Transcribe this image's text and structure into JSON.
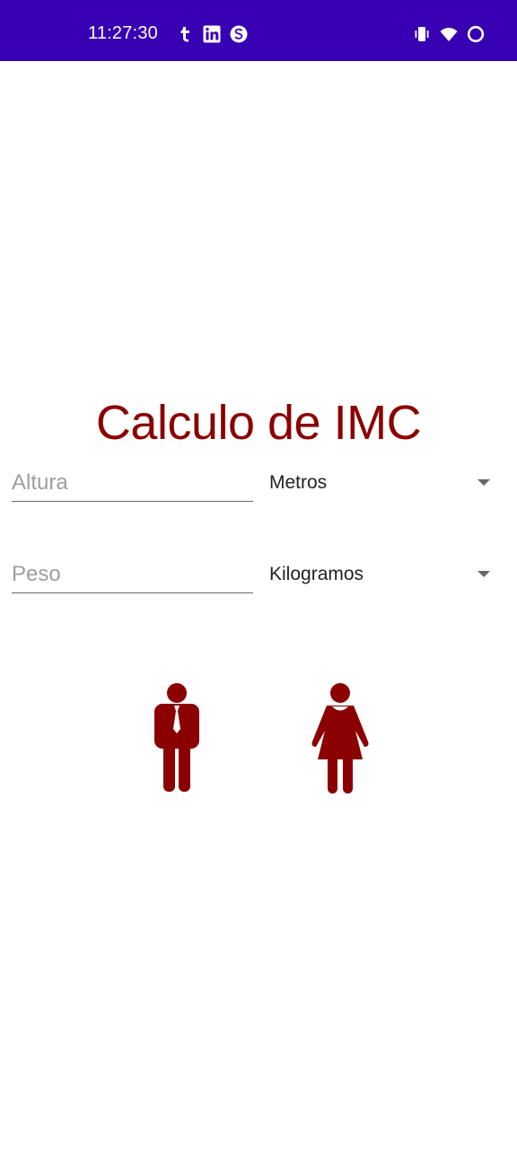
{
  "status_bar": {
    "time": "11:27:30",
    "left_icons": [
      "tumblr-icon",
      "linkedin-icon",
      "sync-icon"
    ],
    "right_icons": [
      "vibrate-icon",
      "wifi-icon",
      "ring-icon"
    ],
    "background": "#3700b3"
  },
  "title": "Calculo de IMC",
  "height_field": {
    "placeholder": "Altura",
    "value": ""
  },
  "height_unit": {
    "selected": "Metros"
  },
  "weight_field": {
    "placeholder": "Peso",
    "value": ""
  },
  "weight_unit": {
    "selected": "Kilogramos"
  },
  "gender_options": [
    "male-figure-icon",
    "female-figure-icon"
  ],
  "colors": {
    "accent": "#8b0000",
    "status_bar": "#3700b3",
    "underline": "#6b6b6b"
  }
}
